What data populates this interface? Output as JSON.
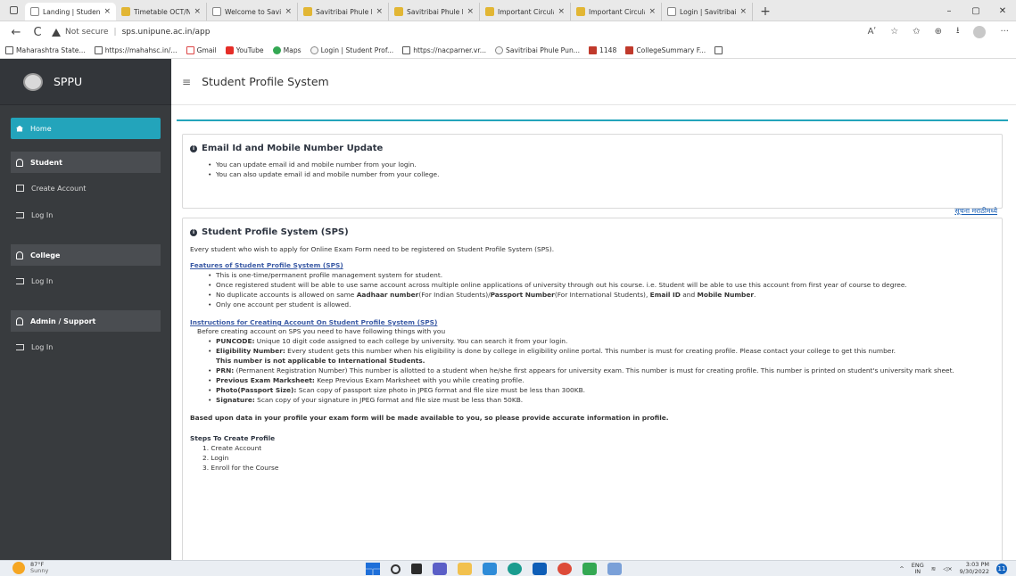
{
  "browser": {
    "tabs": [
      {
        "title": "Landing | Student P",
        "active": true,
        "icon": "sppu-favicon"
      },
      {
        "title": "Timetable OCT/NO",
        "active": false,
        "icon": "doc-favicon"
      },
      {
        "title": "Welcome to Savitri",
        "active": false,
        "icon": "sppu-favicon"
      },
      {
        "title": "Savitribai Phule Pu",
        "active": false,
        "icon": "doc-favicon"
      },
      {
        "title": "Savitribai Phule Pu",
        "active": false,
        "icon": "doc-favicon"
      },
      {
        "title": "Important Circular",
        "active": false,
        "icon": "doc-favicon"
      },
      {
        "title": "Important Circular",
        "active": false,
        "icon": "doc-favicon"
      },
      {
        "title": "Login | Savitribai P",
        "active": false,
        "icon": "sppu-favicon"
      }
    ],
    "tab_close": "×",
    "new_tab": "+",
    "window_controls": {
      "minimize": "–",
      "maximize": "▢",
      "close": "✕"
    },
    "nav": {
      "back": "←",
      "refresh": "C"
    },
    "address": {
      "security": "Not secure",
      "separator": "|",
      "url": "sps.unipune.ac.in/app"
    },
    "toolbar_right": {
      "read_aloud": "Aʹ",
      "favorites_add": "☆",
      "favorites": "✩",
      "collections": "⊕",
      "extensions": "⭳",
      "more": "···"
    },
    "bookmarks": [
      {
        "label": "Maharashtra State...",
        "icon": "page"
      },
      {
        "label": "https://mahahsc.in/...",
        "icon": "page"
      },
      {
        "label": "Gmail",
        "icon": "gmail"
      },
      {
        "label": "YouTube",
        "icon": "youtube"
      },
      {
        "label": "Maps",
        "icon": "maps"
      },
      {
        "label": "Login | Student Prof...",
        "icon": "sppu"
      },
      {
        "label": "https://nacparner.vr...",
        "icon": "page"
      },
      {
        "label": "Savitribai Phule Pun...",
        "icon": "sppu"
      },
      {
        "label": "1148",
        "icon": "pdf"
      },
      {
        "label": "CollegeSummary F...",
        "icon": "pdf"
      },
      {
        "label": "",
        "icon": "page"
      }
    ]
  },
  "sidebar": {
    "brand": "SPPU",
    "items": [
      {
        "label": "Home",
        "type": "active",
        "icon": "home-icon"
      },
      {
        "label": "Student",
        "type": "header",
        "icon": "user-icon"
      },
      {
        "label": "Create Account",
        "type": "item",
        "icon": "id-card-icon"
      },
      {
        "label": "Log In",
        "type": "item",
        "icon": "login-icon"
      },
      {
        "label": "College",
        "type": "header",
        "icon": "user-icon"
      },
      {
        "label": "Log In",
        "type": "item",
        "icon": "login-icon"
      },
      {
        "label": "Admin / Support",
        "type": "header",
        "icon": "user-icon"
      },
      {
        "label": "Log In",
        "type": "item",
        "icon": "login-icon"
      }
    ]
  },
  "header": {
    "menu_icon": "≡",
    "title": "Student Profile System"
  },
  "panel_email": {
    "title": "Email Id and Mobile Number Update",
    "bullets": [
      "You can update email id and mobile number from your login.",
      "You can also update email id and mobile number from your college."
    ]
  },
  "panel_sps": {
    "title": "Student Profile System (SPS)",
    "marathi_link": "सूचना मराठीमध्ये",
    "intro": "Every student who wish to apply for Online Exam Form need to be registered on Student Profile System (SPS).",
    "features_title": "Features of Student Profile System (SPS)",
    "features": {
      "f1": "This is one-time/permanent profile management system for student.",
      "f2": "Once registered student will be able to use same account across multiple online applications of university through out his course. i.e. Student will be able to use this account from first year of course to degree.",
      "f3_a": "No duplicate accounts is allowed on same ",
      "f3_b": "Aadhaar number",
      "f3_c": "(For Indian Students)/",
      "f3_d": "Passport Number",
      "f3_e": "(For International Students), ",
      "f3_f": "Email ID",
      "f3_g": " and ",
      "f3_h": "Mobile Number",
      "f3_i": ".",
      "f4": "Only one account per student is allowed."
    },
    "instructions_title": "Instructions for Creating Account On Student Profile System (SPS)",
    "instructions_intro": "Before creating account on SPS you need to have following things with you",
    "instructions": {
      "puncode_label": "PUNCODE:",
      "puncode_text": " Unique 10 digit code assigned to each college by university. You can search it from your login.",
      "elig_label": "Eligibility Number:",
      "elig_text": " Every student gets this number when his eligibility is done by college in eligibility online portal. This number is must for creating profile. Please contact your college to get this number.",
      "elig_note": "This number is not applicable to International Students.",
      "prn_label": "PRN:",
      "prn_text": " (Permanent Registration Number) This number is allotted to a student when he/she first appears for university exam.  This number is must for creating profile. This number is printed on student's university mark sheet.",
      "prev_label": "Previous Exam Marksheet:",
      "prev_text": " Keep Previous Exam Marksheet with you while creating profile.",
      "photo_label": "Photo(Passport Size):",
      "photo_text": " Scan copy of passport size photo in JPEG format and file size must be less than 300KB.",
      "sig_label": "Signature:",
      "sig_text": " Scan copy of your signature in JPEG format and file size must be less than 50KB."
    },
    "accurate_note": "Based upon data in your profile your exam form will be made available to you, so please provide accurate information in profile.",
    "steps_title": "Steps To Create Profile",
    "steps": [
      "1. Create Account",
      "2. Login",
      "3. Enroll for the Course"
    ]
  },
  "taskbar": {
    "weather_temp": "87°F",
    "weather_desc": "Sunny",
    "tray_chevron": "^",
    "lang_top": "ENG",
    "lang_bottom": "IN",
    "wifi": "≋",
    "volume": "◁×",
    "time": "3:03 PM",
    "date": "9/30/2022",
    "notifications": "11"
  },
  "colors": {
    "accent": "#23a4bb",
    "sidebar": "#383b3e",
    "link": "#3a5aa5"
  }
}
